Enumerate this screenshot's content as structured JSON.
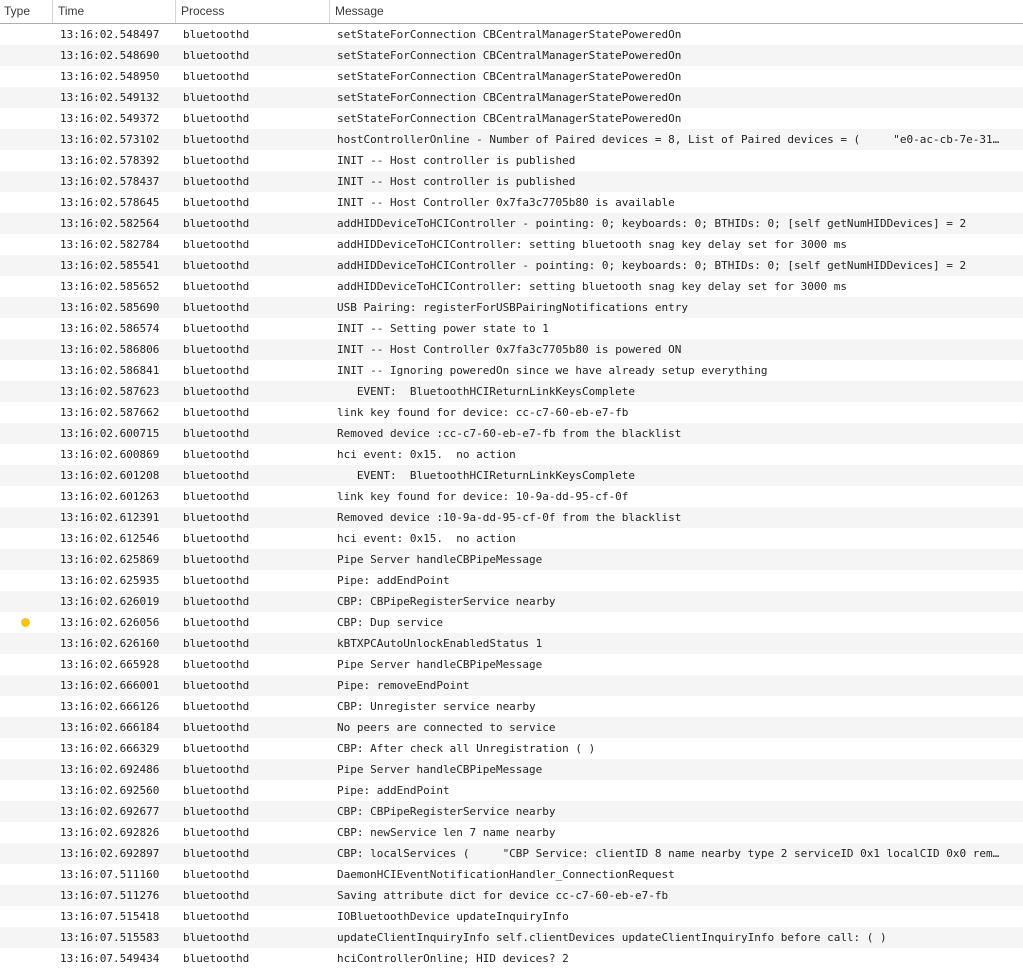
{
  "columns": {
    "type": "Type",
    "time": "Time",
    "process": "Process",
    "message": "Message"
  },
  "colors": {
    "warning_dot": "#f5c518",
    "header_divider": "#8fb2e6"
  },
  "rows": [
    {
      "time": "13:16:02.548497",
      "process": "bluetoothd",
      "message": "setStateForConnection CBCentralManagerStatePoweredOn"
    },
    {
      "time": "13:16:02.548690",
      "process": "bluetoothd",
      "message": "setStateForConnection CBCentralManagerStatePoweredOn"
    },
    {
      "time": "13:16:02.548950",
      "process": "bluetoothd",
      "message": "setStateForConnection CBCentralManagerStatePoweredOn"
    },
    {
      "time": "13:16:02.549132",
      "process": "bluetoothd",
      "message": "setStateForConnection CBCentralManagerStatePoweredOn"
    },
    {
      "time": "13:16:02.549372",
      "process": "bluetoothd",
      "message": "setStateForConnection CBCentralManagerStatePoweredOn"
    },
    {
      "time": "13:16:02.573102",
      "process": "bluetoothd",
      "message": "hostControllerOnline - Number of Paired devices = 8, List of Paired devices = (     \"e0-ac-cb-7e-31…"
    },
    {
      "time": "13:16:02.578392",
      "process": "bluetoothd",
      "message": "INIT -- Host controller is published"
    },
    {
      "time": "13:16:02.578437",
      "process": "bluetoothd",
      "message": "INIT -- Host controller is published"
    },
    {
      "time": "13:16:02.578645",
      "process": "bluetoothd",
      "message": "INIT -- Host Controller 0x7fa3c7705b80 is available"
    },
    {
      "time": "13:16:02.582564",
      "process": "bluetoothd",
      "message": "addHIDDeviceToHCIController - pointing: 0; keyboards: 0; BTHIDs: 0; [self getNumHIDDevices] = 2"
    },
    {
      "time": "13:16:02.582784",
      "process": "bluetoothd",
      "message": "addHIDDeviceToHCIController: setting bluetooth snag key delay set for 3000 ms"
    },
    {
      "time": "13:16:02.585541",
      "process": "bluetoothd",
      "message": "addHIDDeviceToHCIController - pointing: 0; keyboards: 0; BTHIDs: 0; [self getNumHIDDevices] = 2"
    },
    {
      "time": "13:16:02.585652",
      "process": "bluetoothd",
      "message": "addHIDDeviceToHCIController: setting bluetooth snag key delay set for 3000 ms"
    },
    {
      "time": "13:16:02.585690",
      "process": "bluetoothd",
      "message": "USB Pairing: registerForUSBPairingNotifications entry"
    },
    {
      "time": "13:16:02.586574",
      "process": "bluetoothd",
      "message": "INIT -- Setting power state to 1"
    },
    {
      "time": "13:16:02.586806",
      "process": "bluetoothd",
      "message": "INIT -- Host Controller 0x7fa3c7705b80 is powered ON"
    },
    {
      "time": "13:16:02.586841",
      "process": "bluetoothd",
      "message": "INIT -- Ignoring poweredOn since we have already setup everything"
    },
    {
      "time": "13:16:02.587623",
      "process": "bluetoothd",
      "message": "   EVENT:  BluetoothHCIReturnLinkKeysComplete"
    },
    {
      "time": "13:16:02.587662",
      "process": "bluetoothd",
      "message": "link key found for device: cc-c7-60-eb-e7-fb"
    },
    {
      "time": "13:16:02.600715",
      "process": "bluetoothd",
      "message": "Removed device :cc-c7-60-eb-e7-fb from the blacklist"
    },
    {
      "time": "13:16:02.600869",
      "process": "bluetoothd",
      "message": "hci event: 0x15.  no action"
    },
    {
      "time": "13:16:02.601208",
      "process": "bluetoothd",
      "message": "   EVENT:  BluetoothHCIReturnLinkKeysComplete"
    },
    {
      "time": "13:16:02.601263",
      "process": "bluetoothd",
      "message": "link key found for device: 10-9a-dd-95-cf-0f"
    },
    {
      "time": "13:16:02.612391",
      "process": "bluetoothd",
      "message": "Removed device :10-9a-dd-95-cf-0f from the blacklist"
    },
    {
      "time": "13:16:02.612546",
      "process": "bluetoothd",
      "message": "hci event: 0x15.  no action"
    },
    {
      "time": "13:16:02.625869",
      "process": "bluetoothd",
      "message": "Pipe Server handleCBPipeMessage"
    },
    {
      "time": "13:16:02.625935",
      "process": "bluetoothd",
      "message": "Pipe: addEndPoint"
    },
    {
      "time": "13:16:02.626019",
      "process": "bluetoothd",
      "message": "CBP: CBPipeRegisterService nearby"
    },
    {
      "time": "13:16:02.626056",
      "process": "bluetoothd",
      "message": "CBP: Dup service",
      "type_icon": "warning-dot"
    },
    {
      "time": "13:16:02.626160",
      "process": "bluetoothd",
      "message": "kBTXPCAutoUnlockEnabledStatus 1"
    },
    {
      "time": "13:16:02.665928",
      "process": "bluetoothd",
      "message": "Pipe Server handleCBPipeMessage"
    },
    {
      "time": "13:16:02.666001",
      "process": "bluetoothd",
      "message": "Pipe: removeEndPoint"
    },
    {
      "time": "13:16:02.666126",
      "process": "bluetoothd",
      "message": "CBP: Unregister service nearby"
    },
    {
      "time": "13:16:02.666184",
      "process": "bluetoothd",
      "message": "No peers are connected to service"
    },
    {
      "time": "13:16:02.666329",
      "process": "bluetoothd",
      "message": "CBP: After check all Unregistration ( )"
    },
    {
      "time": "13:16:02.692486",
      "process": "bluetoothd",
      "message": "Pipe Server handleCBPipeMessage"
    },
    {
      "time": "13:16:02.692560",
      "process": "bluetoothd",
      "message": "Pipe: addEndPoint"
    },
    {
      "time": "13:16:02.692677",
      "process": "bluetoothd",
      "message": "CBP: CBPipeRegisterService nearby"
    },
    {
      "time": "13:16:02.692826",
      "process": "bluetoothd",
      "message": "CBP: newService len 7 name nearby"
    },
    {
      "time": "13:16:02.692897",
      "process": "bluetoothd",
      "message": "CBP: localServices (     \"CBP Service: clientID 8 name nearby type 2 serviceID 0x1 localCID 0x0 rem…"
    },
    {
      "time": "13:16:07.511160",
      "process": "bluetoothd",
      "message": "DaemonHCIEventNotificationHandler_ConnectionRequest"
    },
    {
      "time": "13:16:07.511276",
      "process": "bluetoothd",
      "message": "Saving attribute dict for device cc-c7-60-eb-e7-fb"
    },
    {
      "time": "13:16:07.515418",
      "process": "bluetoothd",
      "message": "IOBluetoothDevice updateInquiryInfo"
    },
    {
      "time": "13:16:07.515583",
      "process": "bluetoothd",
      "message": "updateClientInquiryInfo self.clientDevices updateClientInquiryInfo before call: ( )"
    },
    {
      "time": "13:16:07.549434",
      "process": "bluetoothd",
      "message": "hciControllerOnline; HID devices? 2"
    }
  ]
}
